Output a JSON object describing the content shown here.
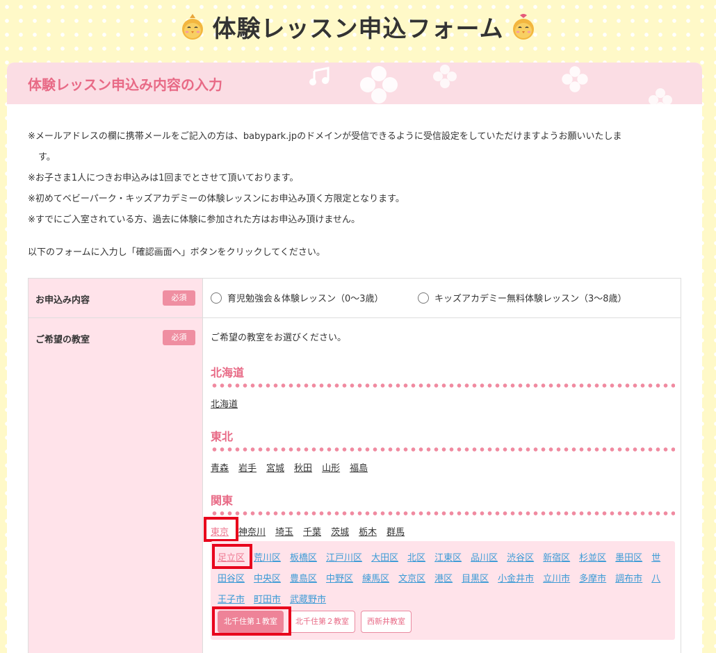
{
  "page_title": "体験レッスン申込フォーム",
  "section_title": "体験レッスン申込み内容の入力",
  "notes": [
    "※メールアドレスの欄に携帯メールをご記入の方は、babypark.jpのドメインが受信できるように受信設定をしていただけますようお願いいたしま",
    "す。",
    "※お子さま1人につきお申込みは1回までとさせて頂いております。",
    "※初めてベビーパーク・キッズアカデミーの体験レッスンにお申込み頂く方限定となります。",
    "※すでにご入室されている方、過去に体験に参加された方はお申込み頂けません。"
  ],
  "instruction": "以下のフォームに入力し「確認画面へ」ボタンをクリックしてください。",
  "form": {
    "application": {
      "label": "お申込み内容",
      "required": "必須",
      "options": [
        "育児勉強会＆体験レッスン（0〜3歳）",
        "キッズアカデミー無料体験レッスン（3〜8歳）"
      ]
    },
    "classroom": {
      "label": "ご希望の教室",
      "required": "必須",
      "prompt": "ご希望の教室をお選びください。",
      "regions": [
        {
          "name": "北海道",
          "prefectures": [
            "北海道"
          ]
        },
        {
          "name": "東北",
          "prefectures": [
            "青森",
            "岩手",
            "宮城",
            "秋田",
            "山形",
            "福島"
          ]
        },
        {
          "name": "関東",
          "prefectures": [
            "東京",
            "神奈川",
            "埼玉",
            "千葉",
            "茨城",
            "栃木",
            "群馬"
          ]
        }
      ],
      "selected_prefecture": "東京",
      "wards": [
        "足立区",
        "荒川区",
        "板橋区",
        "江戸川区",
        "大田区",
        "北区",
        "江東区",
        "品川区",
        "渋谷区",
        "新宿区",
        "杉並区",
        "墨田区",
        "世田谷区",
        "中央区",
        "豊島区",
        "中野区",
        "練馬区",
        "文京区",
        "港区",
        "目黒区",
        "小金井市",
        "立川市",
        "多摩市",
        "調布市",
        "八王子市",
        "町田市",
        "武蔵野市"
      ],
      "selected_ward": "足立区",
      "branches": [
        "北千住第１教室",
        "北千住第２教室",
        "西新井教室"
      ],
      "selected_branch": "北千住第１教室"
    }
  },
  "colors": {
    "accent": "#e86a86",
    "badge": "#ef8ea1",
    "link": "#3c9bd6",
    "highlight": "#e8001c"
  }
}
